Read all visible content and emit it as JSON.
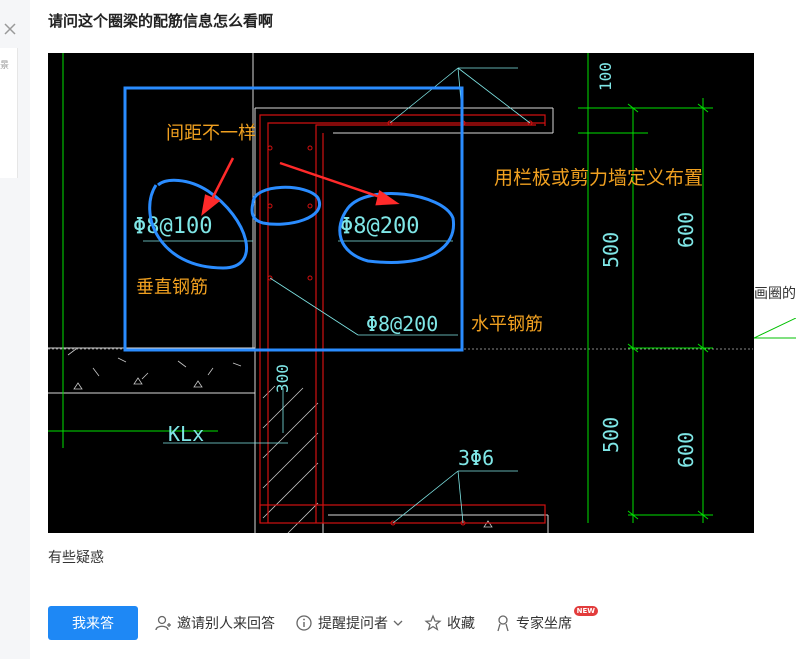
{
  "question": {
    "title": "请问这个圈梁的配筋信息怎么看啊",
    "description": "有些疑惑"
  },
  "side": {
    "left_card_text": "景",
    "right_text": "画圈的"
  },
  "drawing": {
    "annotations": {
      "spacing_differs": "间距不一样",
      "vertical_rebar": "垂直钢筋",
      "horizontal_rebar": "水平钢筋",
      "define_as_railing": "用栏板或剪力墙定义布置"
    },
    "rebar_labels": {
      "vertical": "Φ8@100",
      "horizontal_top": "Φ8@200",
      "horizontal_bottom": "Φ8@200",
      "bottom_bars": "3Φ6"
    },
    "dimensions": {
      "d100": "100",
      "d500_upper": "500",
      "d600_upper": "600",
      "d500_lower": "500",
      "d600_lower": "600",
      "d300": "300"
    },
    "beam_label": "KLx",
    "colors": {
      "background": "#000000",
      "cad_green": "#00e000",
      "cad_cyan": "#7fe6e6",
      "cad_red": "#d01010",
      "markup_blue": "#2a8cff",
      "markup_orange": "#f0a020"
    }
  },
  "actions": {
    "answer": "我来答",
    "invite": "邀请别人来回答",
    "remind": "提醒提问者",
    "favorite": "收藏",
    "expert": "专家坐席",
    "expert_badge": "NEW"
  }
}
